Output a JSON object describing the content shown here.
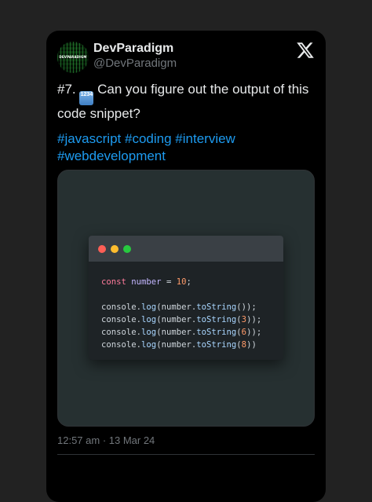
{
  "author": {
    "name": "DevParadigm",
    "handle": "@DevParadigm",
    "avatar_text": "DEVPARADIGM"
  },
  "tweet": {
    "text_before_emoji": "#7. ",
    "emoji_label": "1234",
    "text_after_emoji": " Can you figure out the output of this code snippet?",
    "hashtags": [
      "#javascript",
      "#coding",
      "#interview",
      "#webdevelopment"
    ],
    "timestamp": "12:57 am · 13 Mar 24"
  },
  "code": {
    "line1": {
      "kw": "const",
      "var": "number",
      "op": " = ",
      "num": "10",
      "end": ";"
    },
    "calls": [
      {
        "obj": "console",
        "dot": ".",
        "fn": "log",
        "open": "(",
        "arg": "number",
        "dot2": ".",
        "fn2": "toString",
        "open2": "(",
        "num": "",
        "close": "));"
      },
      {
        "obj": "console",
        "dot": ".",
        "fn": "log",
        "open": "(",
        "arg": "number",
        "dot2": ".",
        "fn2": "toString",
        "open2": "(",
        "num": "3",
        "close": "));"
      },
      {
        "obj": "console",
        "dot": ".",
        "fn": "log",
        "open": "(",
        "arg": "number",
        "dot2": ".",
        "fn2": "toString",
        "open2": "(",
        "num": "6",
        "close": "));"
      },
      {
        "obj": "console",
        "dot": ".",
        "fn": "log",
        "open": "(",
        "arg": "number",
        "dot2": ".",
        "fn2": "toString",
        "open2": "(",
        "num": "8",
        "close": "))"
      }
    ]
  },
  "icons": {
    "platform_logo": "x-logo-icon"
  },
  "colors": {
    "background": "#222222",
    "card": "#000000",
    "hashtag": "#1d9bf0",
    "muted": "#71767b"
  }
}
